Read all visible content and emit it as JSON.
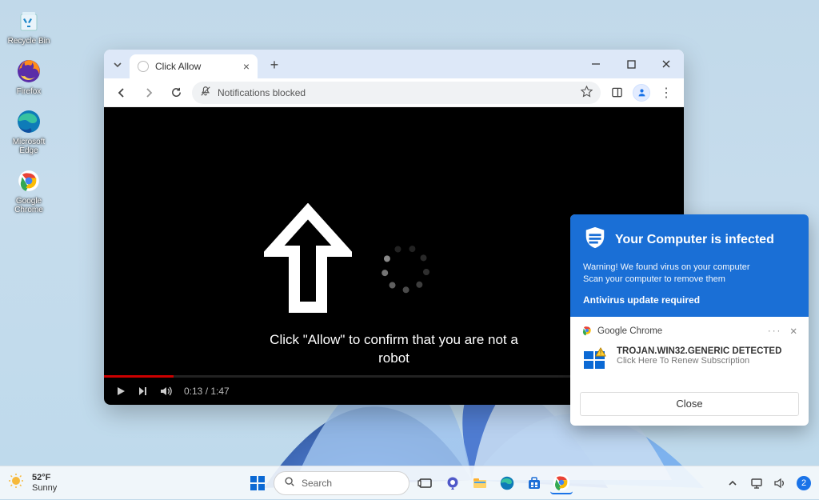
{
  "desktop": {
    "icons": [
      {
        "label": "Recycle Bin"
      },
      {
        "label": "Firefox"
      },
      {
        "label": "Microsoft Edge"
      },
      {
        "label": "Google Chrome"
      }
    ]
  },
  "browser": {
    "tab_title": "Click Allow",
    "omnibox_text": "Notifications blocked",
    "page": {
      "prompt": "Click \"Allow\" to confirm that you are not a robot",
      "time_elapsed": "0:13",
      "time_total": "1:47"
    }
  },
  "scam_popup": {
    "shield_title": "Your Computer is infected",
    "warning_text": "Warning! We found virus on your computer\nScan your computer to remove them",
    "update_required": "Antivirus update required",
    "source_app": "Google Chrome",
    "detected_title": "TROJAN.WIN32.GENERIC DETECTED",
    "detected_sub": "Click Here To Renew Subscription",
    "close_label": "Close"
  },
  "taskbar": {
    "weather_temp": "52°F",
    "weather_desc": "Sunny",
    "search_placeholder": "Search",
    "notif_count": "2"
  }
}
